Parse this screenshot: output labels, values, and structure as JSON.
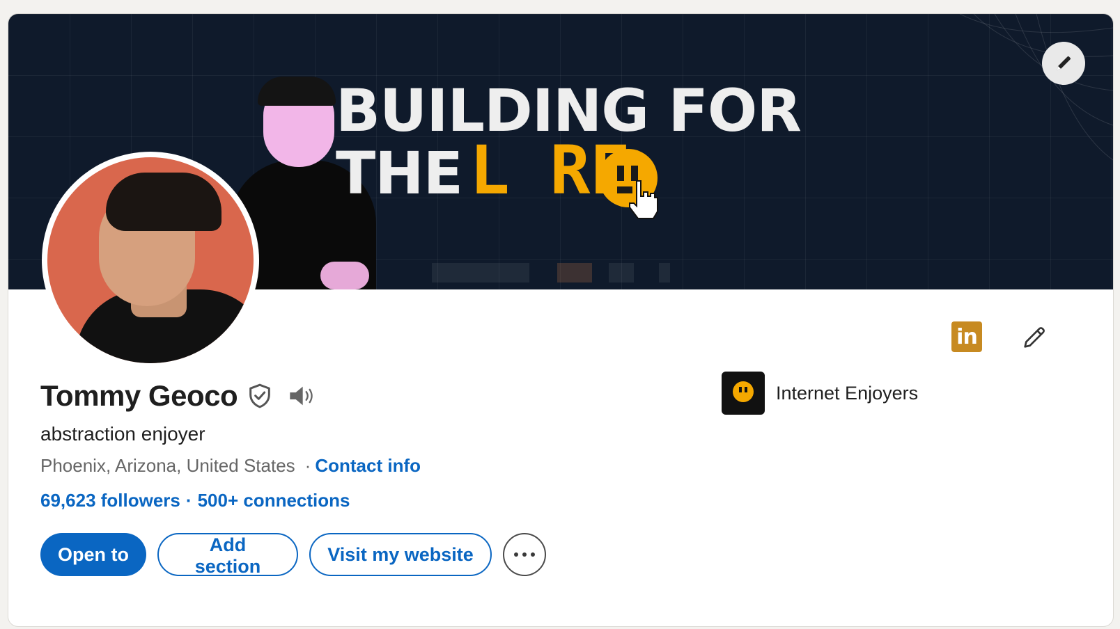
{
  "banner": {
    "title_line1": "BUILDING FOR",
    "title_line2_a": "THE",
    "title_line2_b": "L RE"
  },
  "profile": {
    "name": "Tommy Geoco",
    "headline": "abstraction enjoyer",
    "location": "Phoenix, Arizona, United States",
    "location_separator": "·",
    "contact_info": "Contact info",
    "followers": "69,623 followers",
    "network_separator": "·",
    "connections": "500+ connections"
  },
  "actions": {
    "open_to": "Open to",
    "add_section": "Add section",
    "visit_website": "Visit my website"
  },
  "company": {
    "name": "Internet Enjoyers"
  },
  "badge": {
    "label": "in"
  },
  "colors": {
    "accent": "#0a66c2",
    "banner_bg": "#0f1a2b",
    "lore_yellow": "#f5a800",
    "avatar_bg": "#d9674d",
    "linkedin_badge": "#c78a21"
  },
  "icons": [
    "pencil-icon",
    "verified-shield-icon",
    "speaker-icon",
    "more-dots-icon",
    "linkedin-badge-icon",
    "company-logo"
  ]
}
